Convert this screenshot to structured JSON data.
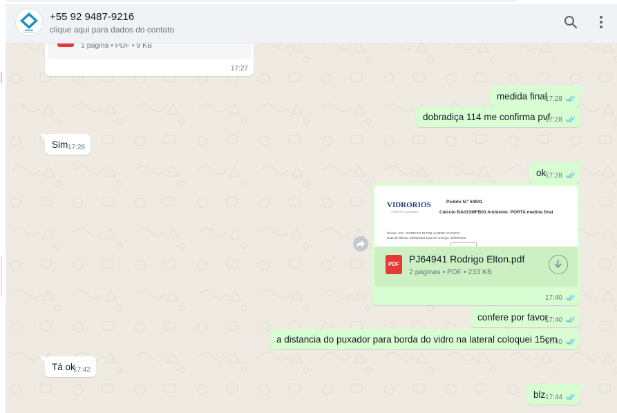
{
  "header": {
    "contact_name": "+55 92 9487-9216",
    "contact_sub": "clique aqui para dados do contato",
    "icons": [
      "search-icon",
      "menu-icon"
    ]
  },
  "colors": {
    "chat_bg": "#efeae2",
    "incoming": "#ffffff",
    "outgoing": "#d9fdd3",
    "read_ticks": "#53bdeb",
    "pdf_red": "#e53935"
  },
  "messages": [
    {
      "dir": "in",
      "type": "document",
      "meta": "1 página • PDF • 9 KB",
      "time": "17:27"
    },
    {
      "dir": "out",
      "text": "medida final",
      "time": "17:28"
    },
    {
      "dir": "out",
      "text": "dobradiça 114 me confirma pvf",
      "time": "17:28"
    },
    {
      "dir": "in",
      "text": "Sim",
      "time": "17:28"
    },
    {
      "dir": "out",
      "text": "ok",
      "time": "17:28"
    },
    {
      "dir": "out",
      "type": "document",
      "preview": {
        "brand": "VIDRORIOS",
        "brand_sub": "VIDROS E ALUMÍNIO",
        "order": "Pedido N.º 64941",
        "calc": "Cálculo BA01SMFB03 Ambiente: PORTA medida final",
        "client": "Cliente:   633 - RODRIGO ELTON ALMEIDA PASSOS",
        "dates": "Data de fábrica: 05/09/2023     Data de entrega: 05/09/2023"
      },
      "filename": "PJ64941 Rodrigo Elton.pdf",
      "meta": "2 páginas • PDF • 233 KB",
      "icon_label": "PDF",
      "time": "17:40"
    },
    {
      "dir": "out",
      "text": "confere por favor",
      "time": "17:40"
    },
    {
      "dir": "out",
      "text": "a distancia do puxador  para borda do vidro na lateral coloquei 15cm",
      "time": "17:40"
    },
    {
      "dir": "in",
      "text": "Tá ok",
      "time": "17:42"
    },
    {
      "dir": "out",
      "text": "blz",
      "time": "17:44"
    }
  ]
}
